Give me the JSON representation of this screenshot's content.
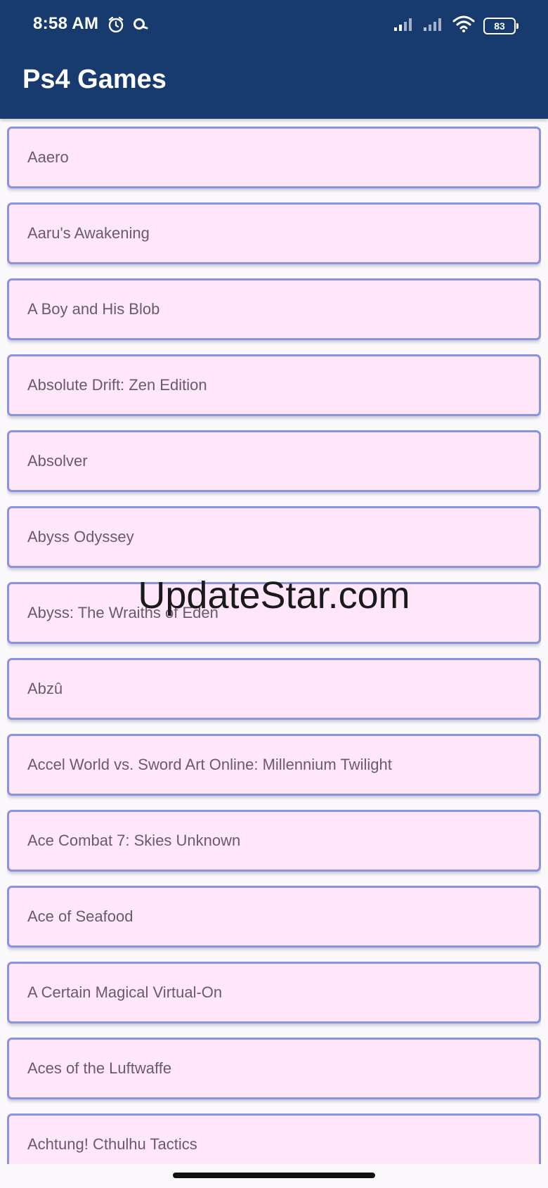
{
  "status_bar": {
    "time": "8:58 AM",
    "left_icons": [
      "alarm-icon",
      "search-notification-icon"
    ],
    "right_icons": [
      "signal-icon",
      "signal-icon",
      "wifi-icon",
      "battery-icon"
    ],
    "battery": "83"
  },
  "app_bar": {
    "title": "Ps4 Games",
    "background": "#173a6f"
  },
  "games": [
    "Aaero",
    "Aaru's Awakening",
    "A Boy and His Blob",
    "Absolute Drift: Zen Edition",
    "Absolver",
    "Abyss Odyssey",
    "Abyss: The Wraiths of Eden",
    "Abzû",
    "Accel World vs. Sword Art Online: Millennium Twilight",
    "Ace Combat 7: Skies Unknown",
    "Ace of Seafood",
    "A Certain Magical Virtual-On",
    "Aces of the Luftwaffe",
    "Achtung! Cthulhu Tactics"
  ],
  "watermark": "UpdateStar.com",
  "colors": {
    "item_background": "#ffe7f9",
    "item_border": "#8a93e0",
    "item_text": "#6b5a6a"
  }
}
